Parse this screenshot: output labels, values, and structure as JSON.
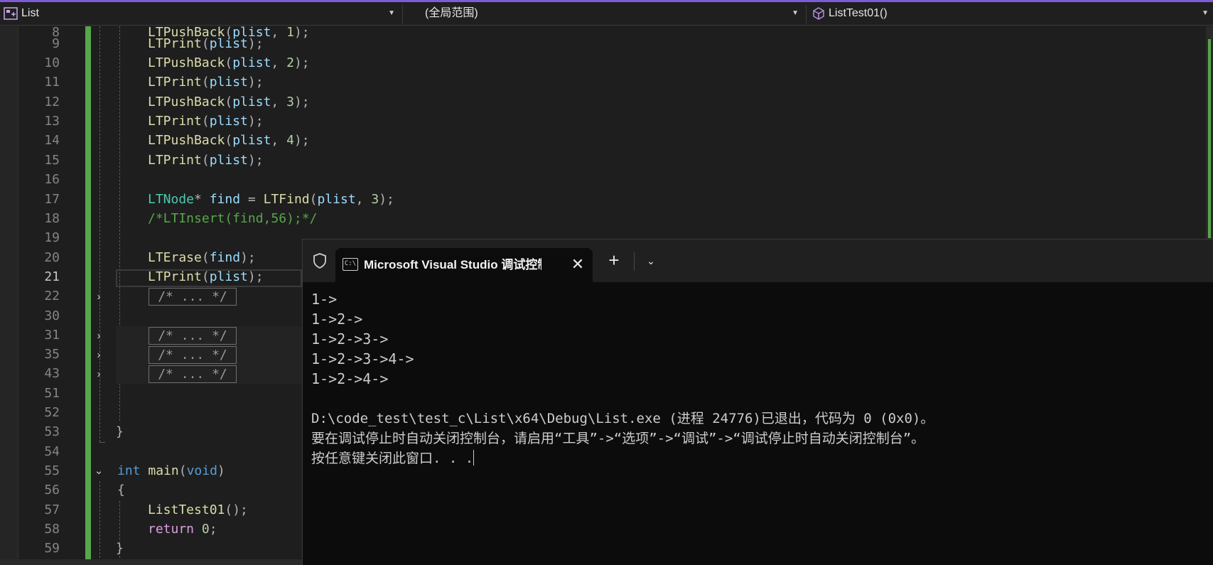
{
  "navbar": {
    "project": "List",
    "scope": "(全局范围)",
    "member": "ListTest01()"
  },
  "editor": {
    "lines": [
      {
        "n": "8",
        "text": "LTPushBack(plist, 1);"
      },
      {
        "n": "9",
        "text": "LTPrint(plist);"
      },
      {
        "n": "10",
        "text": "LTPushBack(plist, 2);"
      },
      {
        "n": "11",
        "text": "LTPrint(plist);"
      },
      {
        "n": "12",
        "text": "LTPushBack(plist, 3);"
      },
      {
        "n": "13",
        "text": "LTPrint(plist);"
      },
      {
        "n": "14",
        "text": "LTPushBack(plist, 4);"
      },
      {
        "n": "15",
        "text": "LTPrint(plist);"
      },
      {
        "n": "16",
        "text": ""
      },
      {
        "n": "17",
        "text": "LTNode* find = LTFind(plist, 3);"
      },
      {
        "n": "18",
        "text": "/*LTInsert(find,56);*/"
      },
      {
        "n": "19",
        "text": ""
      },
      {
        "n": "20",
        "text": "LTErase(find);"
      },
      {
        "n": "21",
        "text": "LTPrint(plist);"
      },
      {
        "n": "22",
        "text": "/* ... */"
      },
      {
        "n": "30",
        "text": ""
      },
      {
        "n": "31",
        "text": "/* ... */"
      },
      {
        "n": "35",
        "text": "/* ... */"
      },
      {
        "n": "43",
        "text": "/* ... */"
      },
      {
        "n": "51",
        "text": ""
      },
      {
        "n": "52",
        "text": ""
      },
      {
        "n": "53",
        "text": "}"
      },
      {
        "n": "54",
        "text": ""
      },
      {
        "n": "55",
        "text": "int main(void)"
      },
      {
        "n": "56",
        "text": "{"
      },
      {
        "n": "57",
        "text": "ListTest01();"
      },
      {
        "n": "58",
        "text": "return 0;"
      },
      {
        "n": "59",
        "text": "}"
      }
    ],
    "current_line": "21",
    "collapsed_label": "/* ... */"
  },
  "terminal": {
    "tab_title": "Microsoft Visual Studio 调试控制台",
    "output": [
      "1->",
      "1->2->",
      "1->2->3->",
      "1->2->3->4->",
      "1->2->4->",
      "",
      "D:\\code_test\\test_c\\List\\x64\\Debug\\List.exe (进程 24776)已退出，代码为 0 (0x0)。",
      "要在调试停止时自动关闭控制台，请启用“工具”->“选项”->“调试”->“调试停止时自动关闭控制台”。",
      "按任意键关闭此窗口. . ."
    ]
  },
  "icons": {
    "project": "class-view-icon",
    "member": "method-cube-icon",
    "shield": "shield-icon",
    "terminal": "terminal-icon"
  }
}
